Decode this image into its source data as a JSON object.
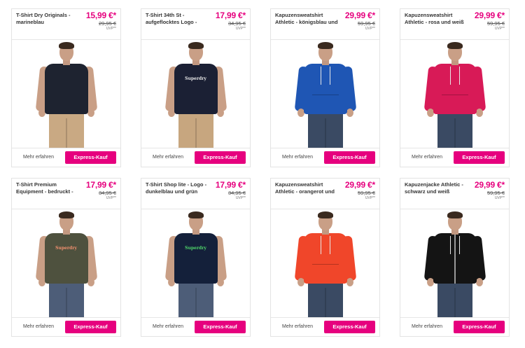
{
  "products": [
    {
      "title": "T-Shirt Dry Originals - marineblau",
      "price": "15,99 €*",
      "old_price": "29,95 €",
      "uvp": "UVP**",
      "more_label": "Mehr erfahren",
      "buy_label": "Express-Kauf",
      "style": "tee",
      "color": "#1e2330",
      "pants_color": "#c9a983",
      "print": ""
    },
    {
      "title": "T-Shirt 34th St - aufgeflocktes Logo -",
      "price": "17,99 €*",
      "old_price": "34,95 €",
      "uvp": "UVP**",
      "more_label": "Mehr erfahren",
      "buy_label": "Express-Kauf",
      "style": "tee",
      "color": "#1b2034",
      "pants_color": "#c7a67f",
      "print": "Superdry",
      "print_color": "#e7e7e7"
    },
    {
      "title": "Kapuzensweatshirt Athletic - königsblau und weiß",
      "price": "29,99 €*",
      "old_price": "59,95 €",
      "uvp": "UVP**",
      "more_label": "Mehr erfahren",
      "buy_label": "Express-Kauf",
      "style": "hoodie",
      "color": "#1f56b4",
      "pants_color": "#3a4a63",
      "print": ""
    },
    {
      "title": "Kapuzensweatshirt Athletic - rosa und weiß",
      "price": "29,99 €*",
      "old_price": "59,95 €",
      "uvp": "UVP**",
      "more_label": "Mehr erfahren",
      "buy_label": "Express-Kauf",
      "style": "hoodie",
      "color": "#d81a57",
      "pants_color": "#3a4a63",
      "print": ""
    },
    {
      "title": "T-Shirt Premium Equipment - bedruckt - khaki und",
      "price": "17,99 €*",
      "old_price": "34,95 €",
      "uvp": "UVP**",
      "more_label": "Mehr erfahren",
      "buy_label": "Express-Kauf",
      "style": "tee",
      "color": "#4e513e",
      "pants_color": "#4d5d78",
      "print": "Superdry",
      "print_color": "#f2906f"
    },
    {
      "title": "T-Shirt Shop lite - Logo - dunkelblau und grün",
      "price": "17,99 €*",
      "old_price": "34,95 €",
      "uvp": "UVP**",
      "more_label": "Mehr erfahren",
      "buy_label": "Express-Kauf",
      "style": "tee",
      "color": "#14203a",
      "pants_color": "#4d5d78",
      "print": "Superdry",
      "print_color": "#4fd66a"
    },
    {
      "title": "Kapuzensweatshirt Athletic - orangerot und weiß",
      "price": "29,99 €*",
      "old_price": "59,95 €",
      "uvp": "UVP**",
      "more_label": "Mehr erfahren",
      "buy_label": "Express-Kauf",
      "style": "hoodie",
      "color": "#f0462a",
      "pants_color": "#3a4a63",
      "print": ""
    },
    {
      "title": "Kapuzenjacke Athletic - schwarz und weiß",
      "price": "29,99 €*",
      "old_price": "59,95 €",
      "uvp": "UVP**",
      "more_label": "Mehr erfahren",
      "buy_label": "Express-Kauf",
      "style": "zip",
      "color": "#141414",
      "pants_color": "#3a4a63",
      "print": ""
    }
  ]
}
